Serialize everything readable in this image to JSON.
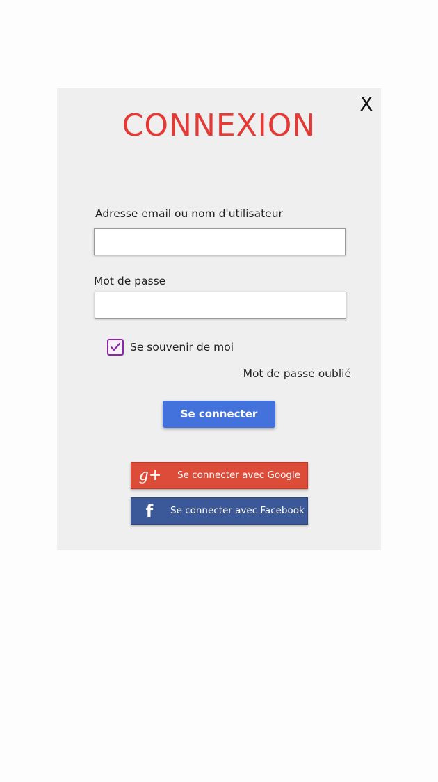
{
  "dialog": {
    "close_label": "X",
    "title": "CONNEXION"
  },
  "form": {
    "email_label": "Adresse email ou nom d'utilisateur",
    "email_value": "",
    "password_label": "Mot de passe",
    "password_value": "",
    "remember_label": "Se souvenir de moi",
    "remember_checked": true,
    "forgot_label": "Mot de passe oublié",
    "login_label": "Se connecter"
  },
  "social": {
    "google_icon": "g+",
    "google_label": "Se connecter avec Google",
    "facebook_icon": "f",
    "facebook_label": "Se connecter avec Facebook"
  },
  "colors": {
    "title": "#e53935",
    "primary_button": "#4472dc",
    "google": "#dd4b39",
    "facebook": "#3b5998",
    "checkbox": "#8e24aa",
    "dialog_bg": "#efefef"
  }
}
